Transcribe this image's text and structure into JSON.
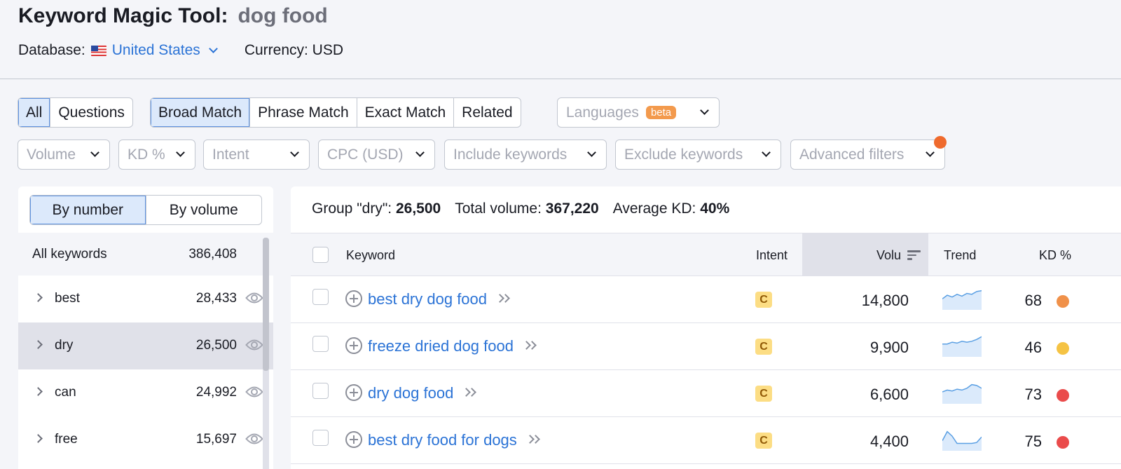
{
  "header": {
    "title": "Keyword Magic Tool:",
    "query": "dog food",
    "database_label": "Database:",
    "database_value": "United States",
    "currency": "Currency: USD"
  },
  "match_tabs": {
    "all": "All",
    "questions": "Questions",
    "broad": "Broad Match",
    "phrase": "Phrase Match",
    "exact": "Exact Match",
    "related": "Related",
    "languages": "Languages",
    "beta": "beta"
  },
  "filters": {
    "volume": "Volume",
    "kd": "KD %",
    "intent": "Intent",
    "cpc": "CPC (USD)",
    "include": "Include keywords",
    "exclude": "Exclude keywords",
    "advanced": "Advanced filters"
  },
  "groups": {
    "by_number": "By number",
    "by_volume": "By volume",
    "all_label": "All keywords",
    "all_count": "386,408",
    "items": [
      {
        "name": "best",
        "count": "28,433"
      },
      {
        "name": "dry",
        "count": "26,500"
      },
      {
        "name": "can",
        "count": "24,992"
      },
      {
        "name": "free",
        "count": "15,697"
      }
    ]
  },
  "summary": {
    "group_label": "Group \"dry\":",
    "group_value": "26,500",
    "total_label": "Total volume:",
    "total_value": "367,220",
    "avg_label": "Average KD:",
    "avg_value": "40%"
  },
  "table": {
    "columns": {
      "keyword": "Keyword",
      "intent": "Intent",
      "volume": "Volu",
      "trend": "Trend",
      "kd": "KD %"
    },
    "rows": [
      {
        "keyword": "best dry dog food",
        "intent": "C",
        "volume": "14,800",
        "kd": "68",
        "kd_color": "#f0914a",
        "trend": [
          0.55,
          0.35,
          0.45,
          0.3,
          0.4,
          0.25,
          0.3,
          0.15,
          0.1
        ]
      },
      {
        "keyword": "freeze dried dog food",
        "intent": "C",
        "volume": "9,900",
        "kd": "46",
        "kd_color": "#f5c344",
        "trend": [
          0.45,
          0.45,
          0.35,
          0.4,
          0.3,
          0.35,
          0.3,
          0.2,
          0.05
        ]
      },
      {
        "keyword": "dry dog food",
        "intent": "C",
        "volume": "6,600",
        "kd": "73",
        "kd_color": "#ea4b4b",
        "trend": [
          0.5,
          0.4,
          0.45,
          0.35,
          0.4,
          0.3,
          0.1,
          0.15,
          0.3
        ]
      },
      {
        "keyword": "best dry food for dogs",
        "intent": "C",
        "volume": "4,400",
        "kd": "75",
        "kd_color": "#ea4b4b",
        "trend": [
          0.6,
          0.1,
          0.35,
          0.75,
          0.75,
          0.75,
          0.75,
          0.7,
          0.4
        ]
      }
    ]
  }
}
